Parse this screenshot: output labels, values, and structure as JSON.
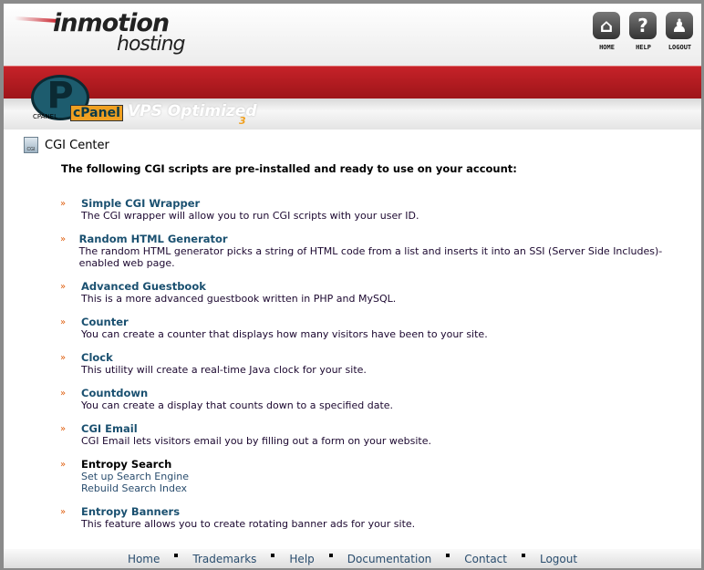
{
  "brand": {
    "line1": "inmotion",
    "line2": "hosting",
    "cpanel": "cPanel",
    "cpanel_small": "CPANEL",
    "edition": "VPS Optimized",
    "version": "3"
  },
  "nav": [
    {
      "label": "HOME",
      "icon": "home-icon",
      "glyph": "⌂"
    },
    {
      "label": "HELP",
      "icon": "help-icon",
      "glyph": "?"
    },
    {
      "label": "LOGOUT",
      "icon": "user-icon",
      "glyph": "♟"
    }
  ],
  "page": {
    "title": "CGI Center",
    "icon_text": "CGI",
    "intro": "The following CGI scripts are pre-installed and ready to use on your account:"
  },
  "items": [
    {
      "title": "Simple CGI Wrapper",
      "desc": "The CGI wrapper will allow you to run CGI scripts with your user ID."
    },
    {
      "title": "Random HTML Generator",
      "desc": "The random HTML generator picks a string of HTML code from a list and inserts it into an SSI (Server Side Includes)-enabled web page."
    },
    {
      "title": "Advanced Guestbook",
      "desc": "This is a more advanced guestbook written in PHP and MySQL."
    },
    {
      "title": "Counter",
      "desc": "You can create a counter that displays how many visitors have been to your site."
    },
    {
      "title": "Clock",
      "desc": "This utility will create a real-time Java clock for your site."
    },
    {
      "title": "Countdown",
      "desc": "You can create a display that counts down to a specified date."
    },
    {
      "title": "CGI Email",
      "desc": "CGI Email lets visitors email you by filling out a form on your website."
    },
    {
      "title": "Entropy Search",
      "links": [
        "Set up Search Engine",
        "Rebuild Search Index"
      ]
    },
    {
      "title": "Entropy Banners",
      "desc": "This feature allows you to create rotating banner ads for your site."
    }
  ],
  "arrow": "»",
  "footer": [
    "Home",
    "Trademarks",
    "Help",
    "Documentation",
    "Contact",
    "Logout"
  ]
}
